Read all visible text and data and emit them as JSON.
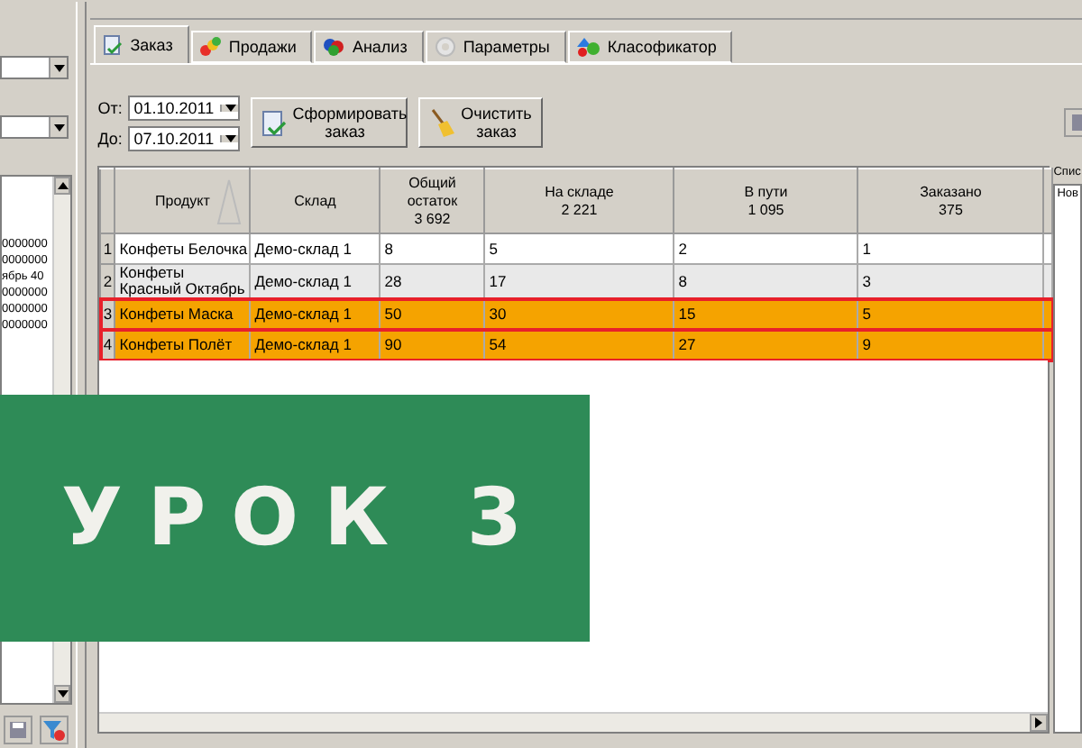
{
  "left_panel": {
    "list_items": [
      "0000000",
      "0000000",
      "ябрь 40",
      "0000000",
      "0000000",
      "0000000"
    ]
  },
  "tabs": [
    {
      "label": "Заказ",
      "selected": true
    },
    {
      "label": "Продажи",
      "selected": false
    },
    {
      "label": "Анализ",
      "selected": false
    },
    {
      "label": "Параметры",
      "selected": false
    },
    {
      "label": "Класофикатор",
      "selected": false
    }
  ],
  "date_from": {
    "label": "От:",
    "value": "01.10.2011"
  },
  "date_to": {
    "label": "До:",
    "value": "07.10.2011"
  },
  "buttons": [
    {
      "label": "Сформировать заказ"
    },
    {
      "label": "Очистить заказ"
    }
  ],
  "table": {
    "columns": [
      {
        "title": "Продукт",
        "sorted": true
      },
      {
        "title": "Склад",
        "sorted": false
      },
      {
        "title": "Общий остаток",
        "total": "3 692",
        "sorted": false
      },
      {
        "title": "На складе",
        "total": "2 221",
        "sorted": false
      },
      {
        "title": "В пути",
        "total": "1 095",
        "sorted": false
      },
      {
        "title": "Заказано",
        "total": "375",
        "sorted": false
      }
    ],
    "rows": [
      {
        "number": "1",
        "highlighted": false,
        "cells": [
          "Конфеты Белочка",
          "Демо-склад 1",
          "8",
          "5",
          "2",
          "1"
        ]
      },
      {
        "number": "2",
        "highlighted": false,
        "cells": [
          "Конфеты Красный Октябрь",
          "Демо-склад 1",
          "28",
          "17",
          "8",
          "3"
        ]
      },
      {
        "number": "3",
        "highlighted": true,
        "cells": [
          "Конфеты Маска",
          "Демо-склад 1",
          "50",
          "30",
          "15",
          "5"
        ]
      },
      {
        "number": "4",
        "highlighted": true,
        "cells": [
          "Конфеты Полёт",
          "Демо-склад 1",
          "90",
          "54",
          "27",
          "9"
        ]
      }
    ]
  },
  "right_panel": {
    "label": "Спис",
    "list_items": [
      "Нов"
    ]
  },
  "banner": {
    "text": "УРОК 3"
  }
}
